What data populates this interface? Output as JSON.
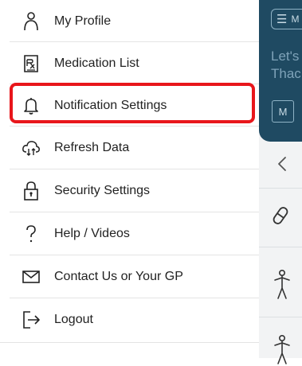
{
  "drawer": {
    "items": [
      {
        "label": "My Profile",
        "icon": "person-icon"
      },
      {
        "label": "Medication List",
        "icon": "prescription-icon"
      },
      {
        "label": "Notification Settings",
        "icon": "bell-icon"
      },
      {
        "label": "Refresh Data",
        "icon": "cloud-sync-icon"
      },
      {
        "label": "Security Settings",
        "icon": "lock-icon"
      },
      {
        "label": "Help / Videos",
        "icon": "question-icon"
      },
      {
        "label": "Contact Us or Your GP",
        "icon": "mail-icon"
      },
      {
        "label": "Logout",
        "icon": "logout-icon"
      }
    ],
    "highlighted_item": "Notification Settings"
  },
  "background_app": {
    "menu_button_partial": "M",
    "greeting_line1": "Let's",
    "greeting_line2": "Thac",
    "chip_label": "M"
  },
  "colors": {
    "header_bg": "#1f4a62",
    "highlight": "#e8161b",
    "text": "#222222"
  }
}
